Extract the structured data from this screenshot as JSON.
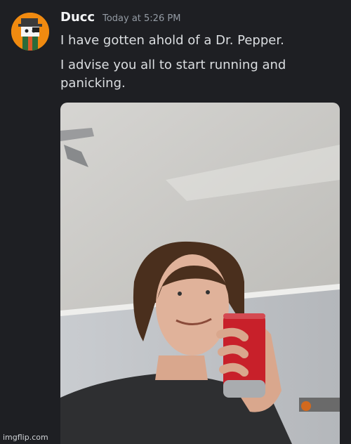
{
  "message": {
    "author": "Ducc",
    "timestamp": "Today at 5:26 PM",
    "lines": [
      "I have gotten ahold of a Dr. Pepper.",
      "I advise you all to start running and panicking."
    ]
  },
  "attachment": {
    "type": "photo"
  },
  "watermark": "imgflip.com",
  "colors": {
    "background": "#1e1f23",
    "username": "#f2f3f5",
    "timestamp": "#949ba4",
    "text": "#dbdee1",
    "avatar_bg": "#f08a10"
  }
}
